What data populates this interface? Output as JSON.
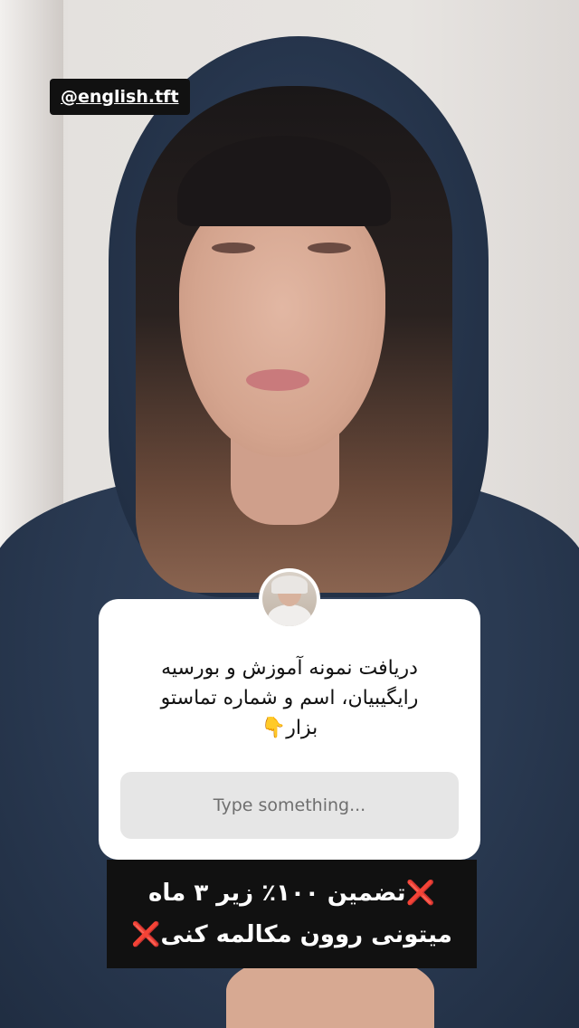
{
  "overlay": {
    "handle": "@english.tft"
  },
  "question_sticker": {
    "question_lines": [
      "دریافت نمونه آموزش و بورسیه",
      "رایگیبیان، اسم و شماره تماستو",
      "بزار👇"
    ],
    "answer_placeholder": "Type something..."
  },
  "caption": {
    "line1_text": "تضمین ۱۰۰٪ زیر ۳ ماه",
    "line2_text": "میتونی روون مکالمه کنی",
    "mark": "❌"
  },
  "colors": {
    "mark": "#e0242b",
    "caption_bg": "#111111",
    "answer_bg": "#e6e6e6"
  }
}
